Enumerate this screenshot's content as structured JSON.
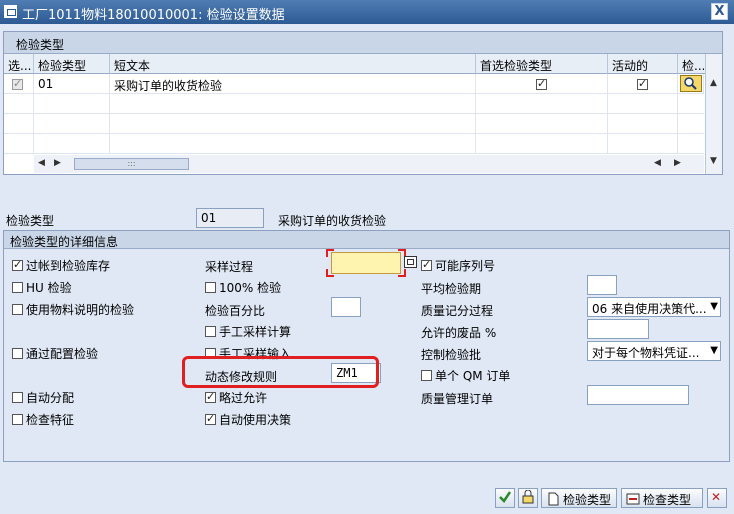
{
  "window": {
    "title": "工厂1011物料18010010001: 检验设置数据",
    "close_label": "X"
  },
  "table": {
    "title": "检验类型",
    "columns": [
      "选...",
      "检验类型",
      "短文本",
      "首选检验类型",
      "活动的",
      "检..."
    ],
    "rows": [
      {
        "selected": true,
        "inspection_type": "01",
        "short_text": "采购订单的收货检验",
        "preferred": true,
        "active": true
      }
    ],
    "scroll_thumb": ":::"
  },
  "header_field": {
    "label": "检验类型",
    "value": "01",
    "description": "采购订单的收货检验"
  },
  "details": {
    "title": "检验类型的详细信息",
    "col1": [
      {
        "label": "过帐到检验库存",
        "checked": true
      },
      {
        "label": "HU 检验",
        "checked": false
      },
      {
        "label": "使用物料说明的检验",
        "checked": false
      },
      {
        "label": "通过配置检验",
        "checked": false
      },
      {
        "label": "自动分配",
        "checked": false
      },
      {
        "label": "检查特征",
        "checked": false
      }
    ],
    "sampling_procedure_label": "采样过程",
    "sampling_procedure_value": "",
    "percent_100_label": "100% 检验",
    "inspection_percent_label": "检验百分比",
    "inspection_percent_value": "",
    "manual_sample_calc_label": "手工采样计算",
    "manual_sample_entry_label": "手工采样输入",
    "dynamic_rule_label": "动态修改规则",
    "dynamic_rule_value": "ZM1",
    "skip_allowed_label": "略过允许",
    "skip_allowed_checked": true,
    "auto_usage_decision_label": "自动使用决策",
    "auto_usage_decision_checked": true,
    "serial_possible_label": "可能序列号",
    "serial_possible_checked": true,
    "avg_period_label": "平均检验期",
    "avg_period_value": "",
    "quality_score_label": "质量记分过程",
    "quality_score_value": "06 来自使用决策代...",
    "allowed_scrap_label": "允许的废品 %",
    "allowed_scrap_value": "",
    "control_lot_label": "控制检验批",
    "control_lot_value": "对于每个物料凭证...",
    "single_qm_label": "单个 QM 订单",
    "single_qm_checked": false,
    "quality_mgmt_order_label": "质量管理订单",
    "quality_mgmt_order_value": ""
  },
  "toolbar": {
    "inspection_type_btn": "检验类型",
    "check_type_btn": "检查类型"
  },
  "colors": {
    "highlight": "#e02020",
    "required_field": "#fff3b0"
  }
}
